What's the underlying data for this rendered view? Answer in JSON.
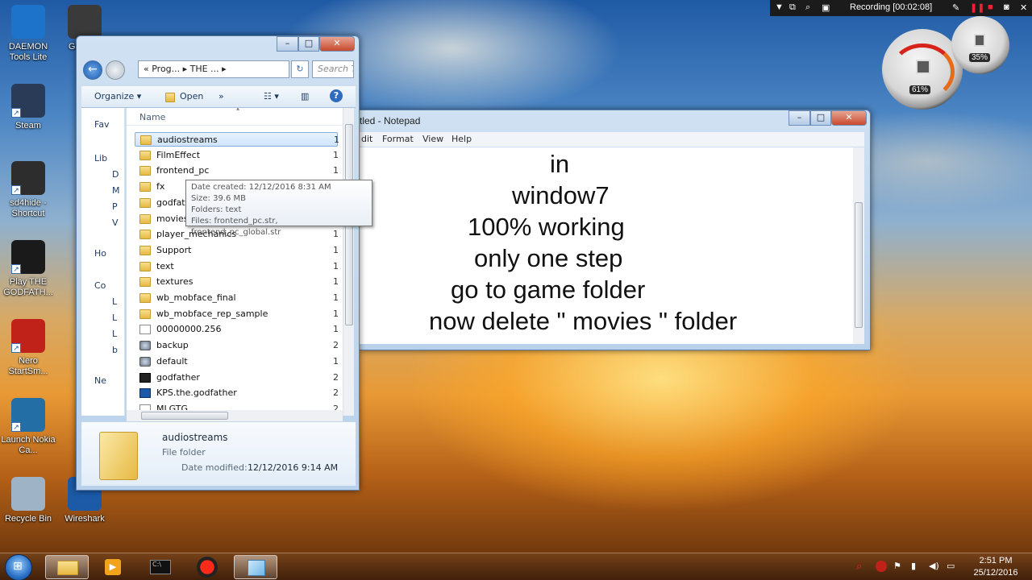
{
  "desktop_icons": [
    {
      "name": "daemon-tools-icon",
      "label": "DAEMON Tools Lite",
      "color": "#1d72c9"
    },
    {
      "name": "steam-icon",
      "label": "Steam",
      "color": "#2a3b57"
    },
    {
      "name": "sd4hide-icon",
      "label": "sd4hide - Shortcut",
      "color": "#2d2d2d"
    },
    {
      "name": "play-godfather-icon",
      "label": "Play THE GODFATH...",
      "color": "#1a1a1a"
    },
    {
      "name": "nero-icon",
      "label": "Nero StartSm...",
      "color": "#c0221a"
    },
    {
      "name": "nokia-suite-icon",
      "label": "Launch Nokia Ca...",
      "color": "#236fa5"
    },
    {
      "name": "recycle-bin-icon",
      "label": "Recycle Bin",
      "color": "#9fb3c6"
    }
  ],
  "desktop_icons_col2": [
    {
      "name": "game-icon",
      "label": "Gam Sh"
    },
    {
      "name": "wireshark-icon",
      "label": "Wireshark"
    }
  ],
  "explorer": {
    "address_parts": [
      "«",
      "Prog...",
      "▸",
      "THE ...",
      "▸"
    ],
    "address_text": "«  Prog... ▸ THE ... ▸",
    "search_placeholder": "Search Th",
    "toolbar": {
      "organize": "Organize ▾",
      "open": "Open",
      "more": "»"
    },
    "nav_items": [
      "Fav",
      "Lib",
      "D",
      "M",
      "P",
      "V",
      "Ho",
      "Co",
      "L",
      "L",
      "L",
      "b",
      "Ne"
    ],
    "column_name": "Name",
    "files": [
      {
        "name": "audiostreams",
        "type": "folder",
        "size": "1",
        "selected": true
      },
      {
        "name": "FilmEffect",
        "type": "folder",
        "size": "1"
      },
      {
        "name": "frontend_pc",
        "type": "folder",
        "size": "1"
      },
      {
        "name": "fx",
        "type": "folder",
        "size": "1"
      },
      {
        "name": "godfath",
        "type": "folder",
        "size": "1"
      },
      {
        "name": "movies",
        "type": "folder",
        "size": "1"
      },
      {
        "name": "player_mechanics",
        "type": "folder",
        "size": "1"
      },
      {
        "name": "Support",
        "type": "folder",
        "size": "1"
      },
      {
        "name": "text",
        "type": "folder",
        "size": "1"
      },
      {
        "name": "textures",
        "type": "folder",
        "size": "1"
      },
      {
        "name": "wb_mobface_final",
        "type": "folder",
        "size": "1"
      },
      {
        "name": "wb_mobface_rep_sample",
        "type": "folder",
        "size": "1"
      },
      {
        "name": "00000000.256",
        "type": "doc",
        "size": "1"
      },
      {
        "name": "backup",
        "type": "gear",
        "size": "2"
      },
      {
        "name": "default",
        "type": "gear",
        "size": "1"
      },
      {
        "name": "godfather",
        "type": "exe",
        "size": "2"
      },
      {
        "name": "KPS.the.godfather",
        "type": "kps",
        "size": "2"
      },
      {
        "name": "MLGTG",
        "type": "doc",
        "size": "2"
      }
    ],
    "tooltip": {
      "date_created": "Date created: 12/12/2016 8:31 AM",
      "size": "Size: 39.6 MB",
      "folders": "Folders: text",
      "files": "Files: frontend_pc.str, frontend_pc_global.str"
    },
    "details": {
      "name": "audiostreams",
      "type": "File folder",
      "date_modified_label": "Date modified:",
      "date_modified": "12/12/2016 9:14 AM"
    }
  },
  "notepad": {
    "title": "tled - Notepad",
    "menu": [
      "dit",
      "Format",
      "View",
      "Help"
    ],
    "lines": [
      "in",
      "window7",
      "100% working",
      "only one step",
      "go to game folder",
      "now delete \" movies \"  folder"
    ]
  },
  "recording": {
    "text": "Recording [00:02:08]"
  },
  "gadgets": {
    "cpu": "61%",
    "ram": "35%"
  },
  "taskbar": {
    "time": "2:51 PM",
    "date": "25/12/2016"
  }
}
